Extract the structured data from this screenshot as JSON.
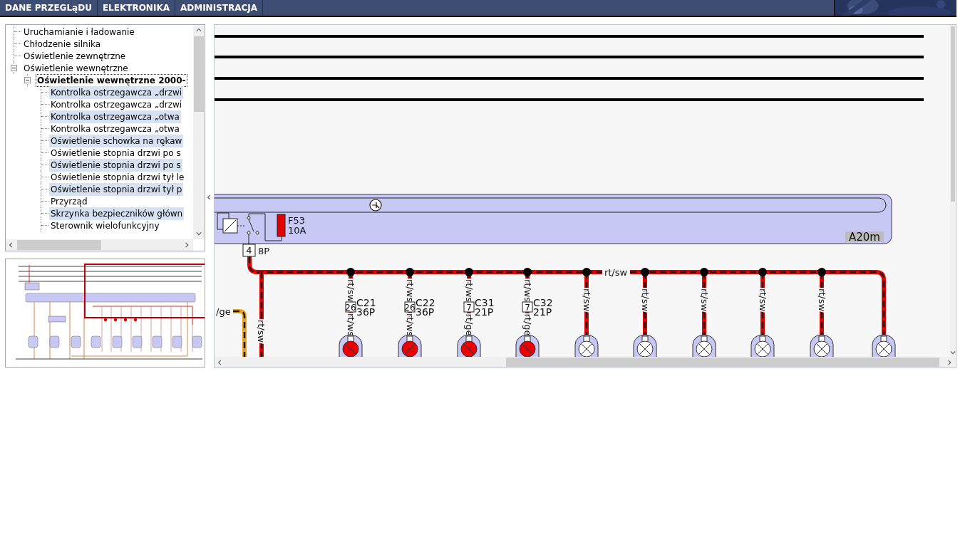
{
  "nav": {
    "tabs": [
      {
        "label": "DANE PRZEGLąDU",
        "selected": false
      },
      {
        "label": "ELEKTRONIKA",
        "selected": false
      },
      {
        "label": "ADMINISTRACJA",
        "selected": false
      }
    ]
  },
  "tree": {
    "items": [
      {
        "label": "Uruchamianie i ładowanie",
        "selected": false
      },
      {
        "label": "Chłodzenie silnika",
        "selected": false
      },
      {
        "label": "Oświetlenie zewnętrzne",
        "selected": false
      },
      {
        "label": "Oświetlenie wewnętrzne",
        "selected": false,
        "expanded": true,
        "children": [
          {
            "label": "Oświetlenie wewnętrzne 2000-",
            "selected": true,
            "expanded": true,
            "children": [
              {
                "label": "Kontrolka ostrzegawcza „drzwi",
                "selected": false,
                "highlighted": true
              },
              {
                "label": "Kontrolka ostrzegawcza „drzwi",
                "selected": false,
                "highlighted": false
              },
              {
                "label": "Kontrolka ostrzegawcza „otwa",
                "selected": false,
                "highlighted": true
              },
              {
                "label": "Kontrolka ostrzegawcza „otwa",
                "selected": false,
                "highlighted": false
              },
              {
                "label": "Oświetlenie schowka na rękaw",
                "selected": false,
                "highlighted": true
              },
              {
                "label": "Oświetlenie stopnia drzwi po s",
                "selected": false,
                "highlighted": false
              },
              {
                "label": "Oświetlenie stopnia drzwi po s",
                "selected": false,
                "highlighted": true
              },
              {
                "label": "Oświetlenie stopnia drzwi tył le",
                "selected": false,
                "highlighted": false
              },
              {
                "label": "Oświetlenie stopnia drzwi tył p",
                "selected": false,
                "highlighted": true
              },
              {
                "label": "Przyrząd",
                "selected": false,
                "highlighted": false
              },
              {
                "label": "Skrzynka bezpieczników główn",
                "selected": false,
                "highlighted": true
              },
              {
                "label": "Sterownik wielofunkcyjny",
                "selected": false,
                "highlighted": false
              }
            ]
          }
        ]
      }
    ]
  },
  "diagram": {
    "module": {
      "label": "A20m"
    },
    "fuse": {
      "name": "F53",
      "rating": "10A"
    },
    "output": {
      "pin": "4",
      "connector": "8P"
    },
    "bus_wire": "rt/sw",
    "feed_wire": "rt/sw",
    "side_wire": "/ge",
    "branches": [
      {
        "kind": "indicator",
        "wire": "rt/sw",
        "pin": "26",
        "connector": "C21",
        "pins": "36P",
        "wire_below": "rt/ws"
      },
      {
        "kind": "indicator",
        "wire": "rt/ws",
        "pin": "26",
        "connector": "C22",
        "pins": "36P",
        "wire_below": "rt/ws"
      },
      {
        "kind": "indicator",
        "wire": "rt/ws",
        "pin": "7",
        "connector": "C31",
        "pins": "21P",
        "wire_below": "rt/ge"
      },
      {
        "kind": "indicator",
        "wire": "rt/ws",
        "pin": "7",
        "connector": "C32",
        "pins": "21P",
        "wire_below": "rt/ge"
      },
      {
        "kind": "bulb",
        "wire": "rt/sw"
      },
      {
        "kind": "bulb",
        "wire": "rt/sw"
      },
      {
        "kind": "bulb",
        "wire": "rt/sw"
      },
      {
        "kind": "bulb",
        "wire": "rt/sw"
      },
      {
        "kind": "bulb",
        "wire": "rt/sw"
      },
      {
        "kind": "bulb"
      }
    ]
  }
}
